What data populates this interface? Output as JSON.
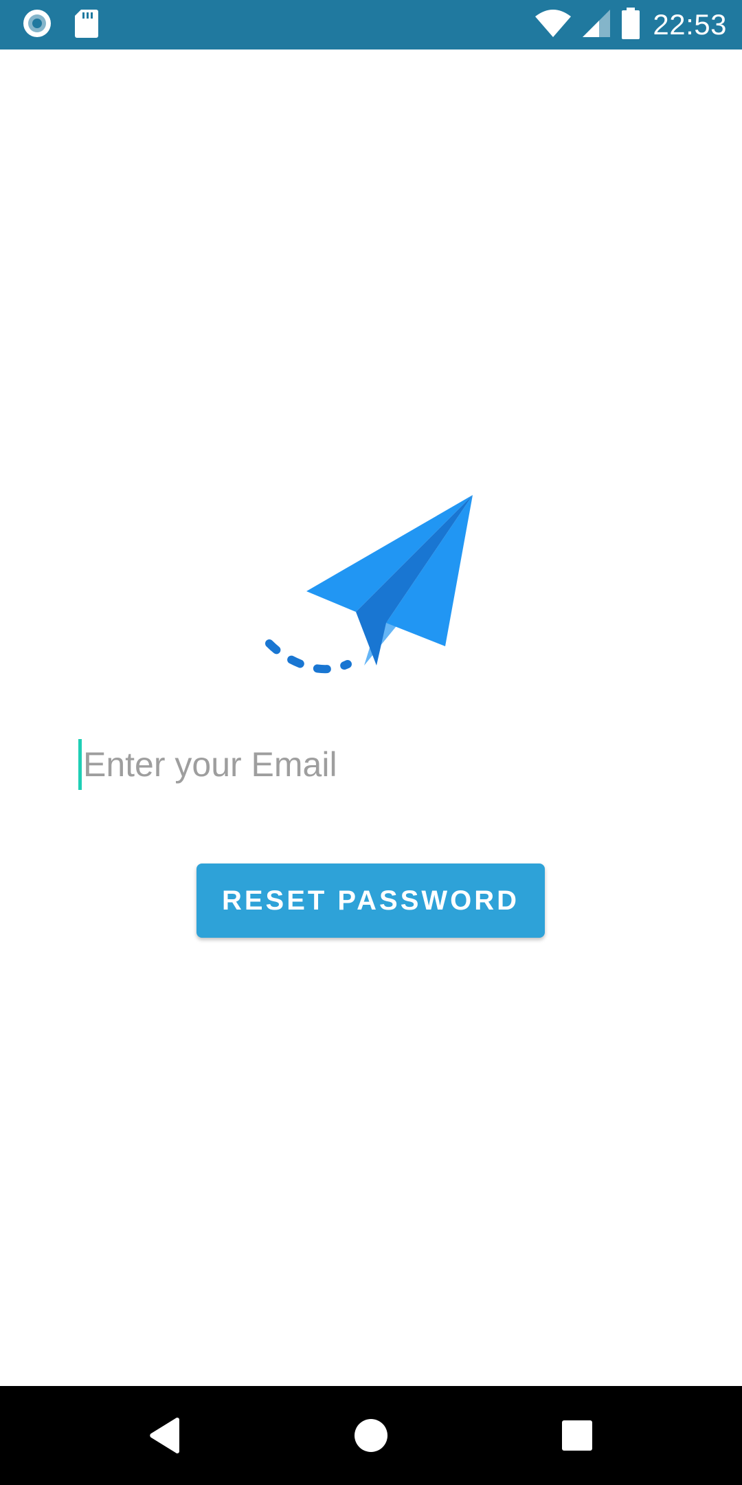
{
  "status_bar": {
    "time": "22:53",
    "icons": [
      "record-icon",
      "sd-card-icon",
      "wifi-icon",
      "signal-icon",
      "battery-icon"
    ]
  },
  "logo": {
    "icon": "paper-plane-icon"
  },
  "email": {
    "placeholder": "Enter your Email",
    "value": ""
  },
  "reset_button": {
    "label": "RESET PASSWORD"
  },
  "nav_bar": {
    "icons": [
      "back-icon",
      "home-icon",
      "recents-icon"
    ]
  },
  "colors": {
    "status_bar": "#20799f",
    "accent": "#2ea2d8",
    "cursor": "#1fcfb5",
    "plane_light": "#2196f3",
    "plane_dark": "#1976d2"
  }
}
